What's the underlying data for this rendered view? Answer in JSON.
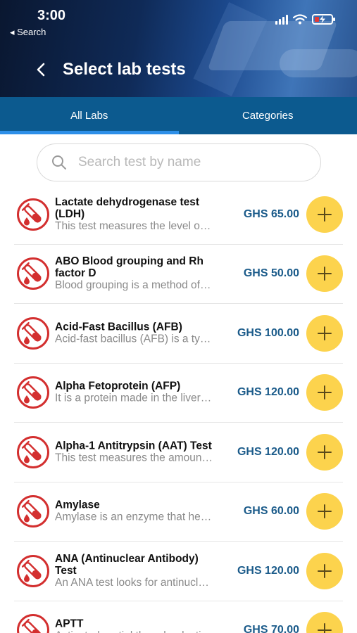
{
  "status_bar": {
    "time": "3:00",
    "back_label": "◂ Search"
  },
  "header": {
    "title": "Select lab tests"
  },
  "tabs": [
    {
      "label": "All Labs",
      "active": true
    },
    {
      "label": "Categories",
      "active": false
    }
  ],
  "search": {
    "placeholder": "Search test by name",
    "value": ""
  },
  "colors": {
    "accent": "#0c5a8f",
    "tab_indicator": "#2d8fe8",
    "price": "#1b5b8a",
    "add_button": "#fcd34d",
    "icon_red": "#d32f2f"
  },
  "tests": [
    {
      "name": " Lactate dehydrogenase test (LDH)",
      "desc": "This test measures the level of lactate dehydrogenase",
      "price": "GHS 65.00"
    },
    {
      "name": "ABO Blood grouping and Rh factor D",
      "desc": "Blood grouping is a method of determining",
      "price": "GHS 50.00"
    },
    {
      "name": "Acid-Fast Bacillus (AFB)",
      "desc": "Acid-fast bacillus (AFB) is a type of bacteria",
      "price": "GHS 100.00"
    },
    {
      "name": "Alpha Fetoprotein (AFP)",
      "desc": "It is a protein made in the liver of a developing baby",
      "price": "GHS 120.00"
    },
    {
      "name": "Alpha-1 Antitrypsin (AAT) Test",
      "desc": "This test measures the amount of AAT in the blood",
      "price": "GHS 120.00"
    },
    {
      "name": "Amylase",
      "desc": "Amylase is an enzyme that helps digest",
      "price": "GHS 60.00"
    },
    {
      "name": "ANA (Antinuclear Antibody) Test",
      "desc": "An ANA test looks for antinuclear antibodies",
      "price": "GHS 120.00"
    },
    {
      "name": "APTT",
      "desc": "Activated partial thromboplastin time",
      "price": "GHS 70.00"
    }
  ]
}
